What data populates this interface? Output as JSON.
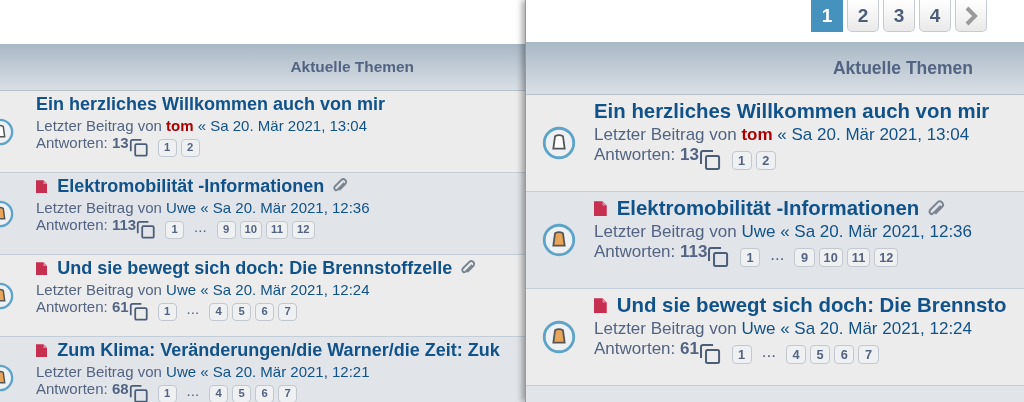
{
  "views": [
    {
      "header": "Aktuelle Themen",
      "topics": [
        {
          "title": "Ein herzliches Willkommen auch von mir",
          "unread": false,
          "attachment": false,
          "prefix": "Letzter Beitrag von",
          "author": "tom",
          "author_highlighted": true,
          "date": "« Sa 20. Mär 2021, 13:04",
          "replies_label": "Antworten:",
          "replies": "13",
          "pages": [
            "1",
            "2"
          ]
        },
        {
          "title": "Elektromobilität -Informationen",
          "unread": true,
          "attachment": true,
          "prefix": "Letzter Beitrag von",
          "author": "Uwe",
          "author_highlighted": false,
          "date": "« Sa 20. Mär 2021, 12:36",
          "replies_label": "Antworten:",
          "replies": "113",
          "pages": [
            "1",
            "...",
            "9",
            "10",
            "11",
            "12"
          ]
        },
        {
          "title": "Und sie bewegt sich doch: Die Brennstoffzelle",
          "unread": true,
          "attachment": true,
          "prefix": "Letzter Beitrag von",
          "author": "Uwe",
          "author_highlighted": false,
          "date": "« Sa 20. Mär 2021, 12:24",
          "replies_label": "Antworten:",
          "replies": "61",
          "pages": [
            "1",
            "...",
            "4",
            "5",
            "6",
            "7"
          ]
        },
        {
          "title": "Zum Klima: Veränderungen/die Warner/die Zeit: Zuk",
          "unread": true,
          "attachment": false,
          "prefix": "Letzter Beitrag von",
          "author": "Uwe",
          "author_highlighted": false,
          "date": "« Sa 20. Mär 2021, 12:21",
          "replies_label": "Antworten:",
          "replies": "68",
          "pages": [
            "1",
            "...",
            "4",
            "5",
            "6",
            "7"
          ]
        }
      ]
    },
    {
      "header": "Aktuelle Themen",
      "pagination": [
        {
          "label": "1",
          "selected": true
        },
        {
          "label": "2",
          "selected": false
        },
        {
          "label": "3",
          "selected": false
        },
        {
          "label": "4",
          "selected": false
        }
      ],
      "topics": [
        {
          "title": "Ein herzliches Willkommen auch von mir",
          "unread": false,
          "attachment": false,
          "prefix": "Letzter Beitrag von",
          "author": "tom",
          "author_highlighted": true,
          "date": "« Sa 20. Mär 2021, 13:04",
          "replies_label": "Antworten:",
          "replies": "13",
          "pages": [
            "1",
            "2"
          ]
        },
        {
          "title": "Elektromobilität -Informationen",
          "unread": true,
          "attachment": true,
          "prefix": "Letzter Beitrag von",
          "author": "Uwe",
          "author_highlighted": false,
          "date": "« Sa 20. Mär 2021, 12:36",
          "replies_label": "Antworten:",
          "replies": "113",
          "pages": [
            "1",
            "...",
            "9",
            "10",
            "11",
            "12"
          ]
        },
        {
          "title": "Und sie bewegt sich doch: Die Brennsto",
          "unread": true,
          "attachment": false,
          "prefix": "Letzter Beitrag von",
          "author": "Uwe",
          "author_highlighted": false,
          "date": "« Sa 20. Mär 2021, 12:24",
          "replies_label": "Antworten:",
          "replies": "61",
          "pages": [
            "1",
            "...",
            "4",
            "5",
            "6",
            "7"
          ]
        }
      ]
    }
  ]
}
